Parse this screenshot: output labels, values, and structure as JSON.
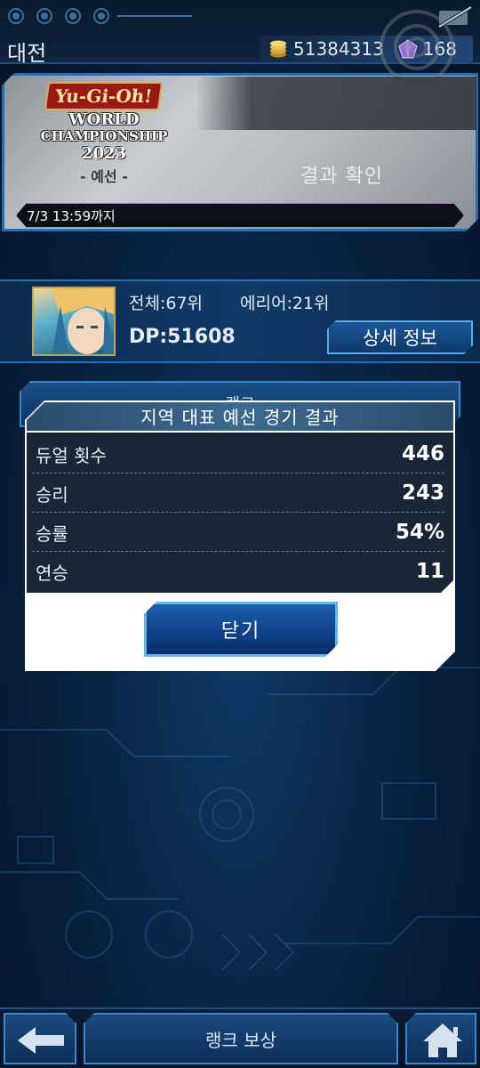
{
  "header": {
    "title": "대전",
    "currency": {
      "gold_amount": "51384313",
      "gem_amount": "168"
    }
  },
  "event": {
    "logo_top": "Yu-Gi-Oh!",
    "logo_line1": "WORLD",
    "logo_line2": "CHAMPIONSHIP",
    "logo_line3": "2023",
    "logo_sub": "- 예선 -",
    "result_label": "결과 확인",
    "deadline": "7/3 13:59까지"
  },
  "player": {
    "overall_rank": "전체:67위",
    "area_rank": "에리어:21위",
    "dp": "DP:51608",
    "detail_button": "상세 정보"
  },
  "background_button": "랭크",
  "modal": {
    "title": "지역 대표 예선 경기 결과",
    "stats": [
      {
        "label": "듀얼 횟수",
        "value": "446"
      },
      {
        "label": "승리",
        "value": "243"
      },
      {
        "label": "승률",
        "value": "54%"
      },
      {
        "label": "연승",
        "value": "11"
      }
    ],
    "close_button": "닫기"
  },
  "footer": {
    "reward_button": "랭크 보상"
  }
}
